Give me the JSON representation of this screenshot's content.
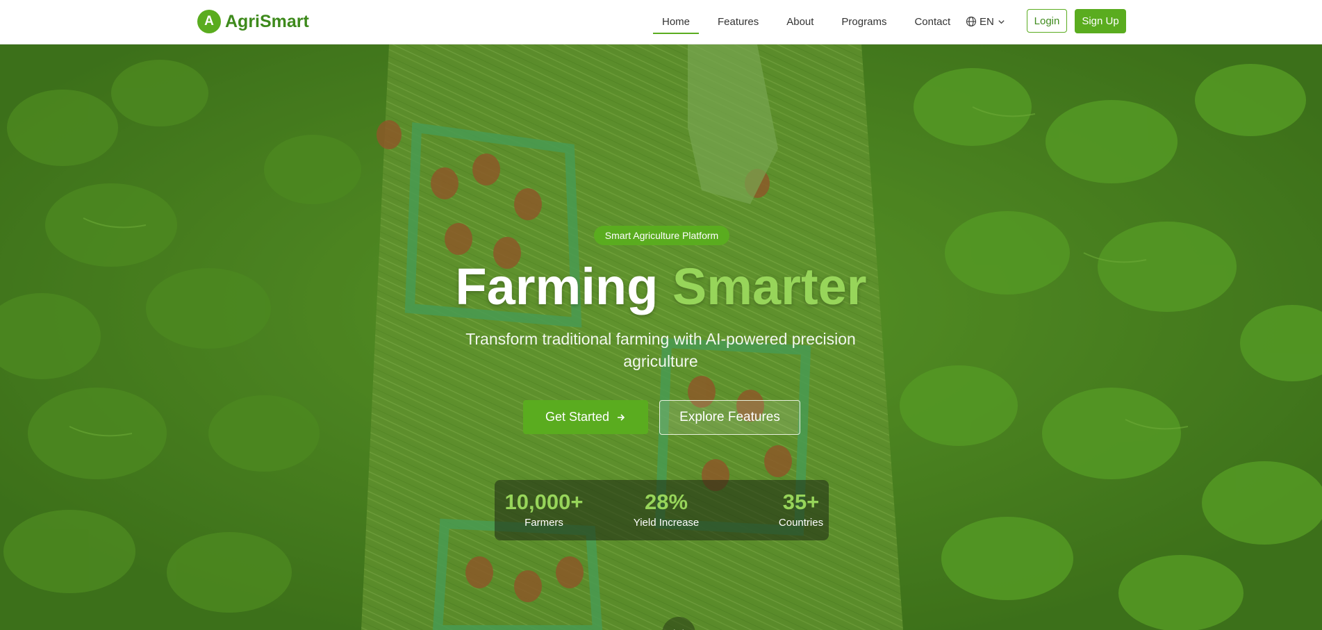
{
  "colors": {
    "brand": "#5aac1f",
    "brand_dark": "#3e8a1c",
    "accent_light": "#97d55a",
    "header_bg": "#ffffff"
  },
  "header": {
    "logo_letter": "A",
    "brand_name": "AgriSmart",
    "nav": [
      {
        "label": "Home",
        "active": true
      },
      {
        "label": "Features",
        "active": false
      },
      {
        "label": "About",
        "active": false
      },
      {
        "label": "Programs",
        "active": false
      },
      {
        "label": "Contact",
        "active": false
      }
    ],
    "language": {
      "icon": "globe-icon",
      "label": "EN",
      "dropdown_icon": "chevron-down-icon"
    },
    "login_label": "Login",
    "signup_label": "Sign Up"
  },
  "hero": {
    "badge": "Smart Agriculture Platform",
    "title_main": "Farming",
    "title_accent": "Smarter",
    "subtitle": "Transform traditional farming with AI-powered precision agriculture",
    "primary_cta": {
      "label": "Get Started",
      "icon": "arrow-right-icon"
    },
    "secondary_cta": {
      "label": "Explore Features"
    },
    "stats": [
      {
        "value": "10,000+",
        "label": "Farmers"
      },
      {
        "value": "28%",
        "label": "Yield Increase"
      },
      {
        "value": "35+",
        "label": "Countries"
      }
    ],
    "scroll_icon": "chevron-down-icon"
  }
}
